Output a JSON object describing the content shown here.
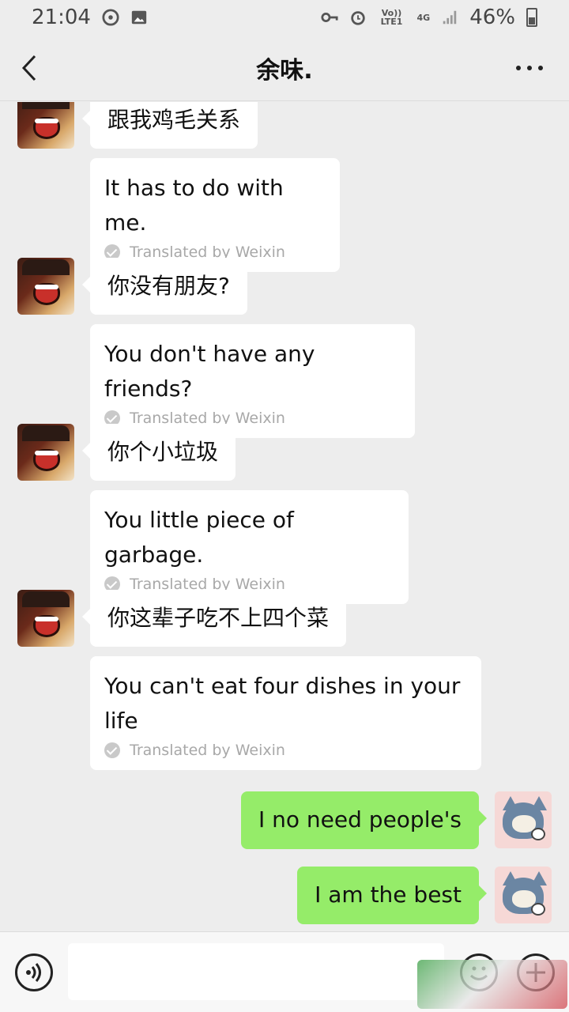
{
  "status_bar": {
    "time": "21:04",
    "volte": "Vo)) LTE1",
    "network": "4G",
    "battery": "46%",
    "icons": [
      "vpn-key-icon",
      "alarm-icon",
      "signal-icon",
      "battery-icon",
      "hotspot-icon",
      "image-icon"
    ]
  },
  "header": {
    "title": "余味."
  },
  "messages": [
    {
      "side": "left",
      "text": "跟我鸡毛关系",
      "translation": "It has to do with me.",
      "translated_by": "Translated by Weixin"
    },
    {
      "side": "left",
      "text": "你没有朋友?",
      "translation": "You don't have any friends?",
      "translated_by": "Translated by Weixin"
    },
    {
      "side": "left",
      "text": "你个小垃圾",
      "translation": "You little piece of garbage.",
      "translated_by": "Translated by Weixin"
    },
    {
      "side": "left",
      "text": "你这辈子吃不上四个菜",
      "translation": "You can't eat four dishes in your life",
      "translated_by": "Translated by Weixin"
    },
    {
      "side": "right",
      "text": "I no need people's"
    },
    {
      "side": "right",
      "text": "I am the best"
    }
  ],
  "colors": {
    "background": "#ededed",
    "my_bubble": "#95ec69",
    "their_bubble": "#ffffff"
  }
}
